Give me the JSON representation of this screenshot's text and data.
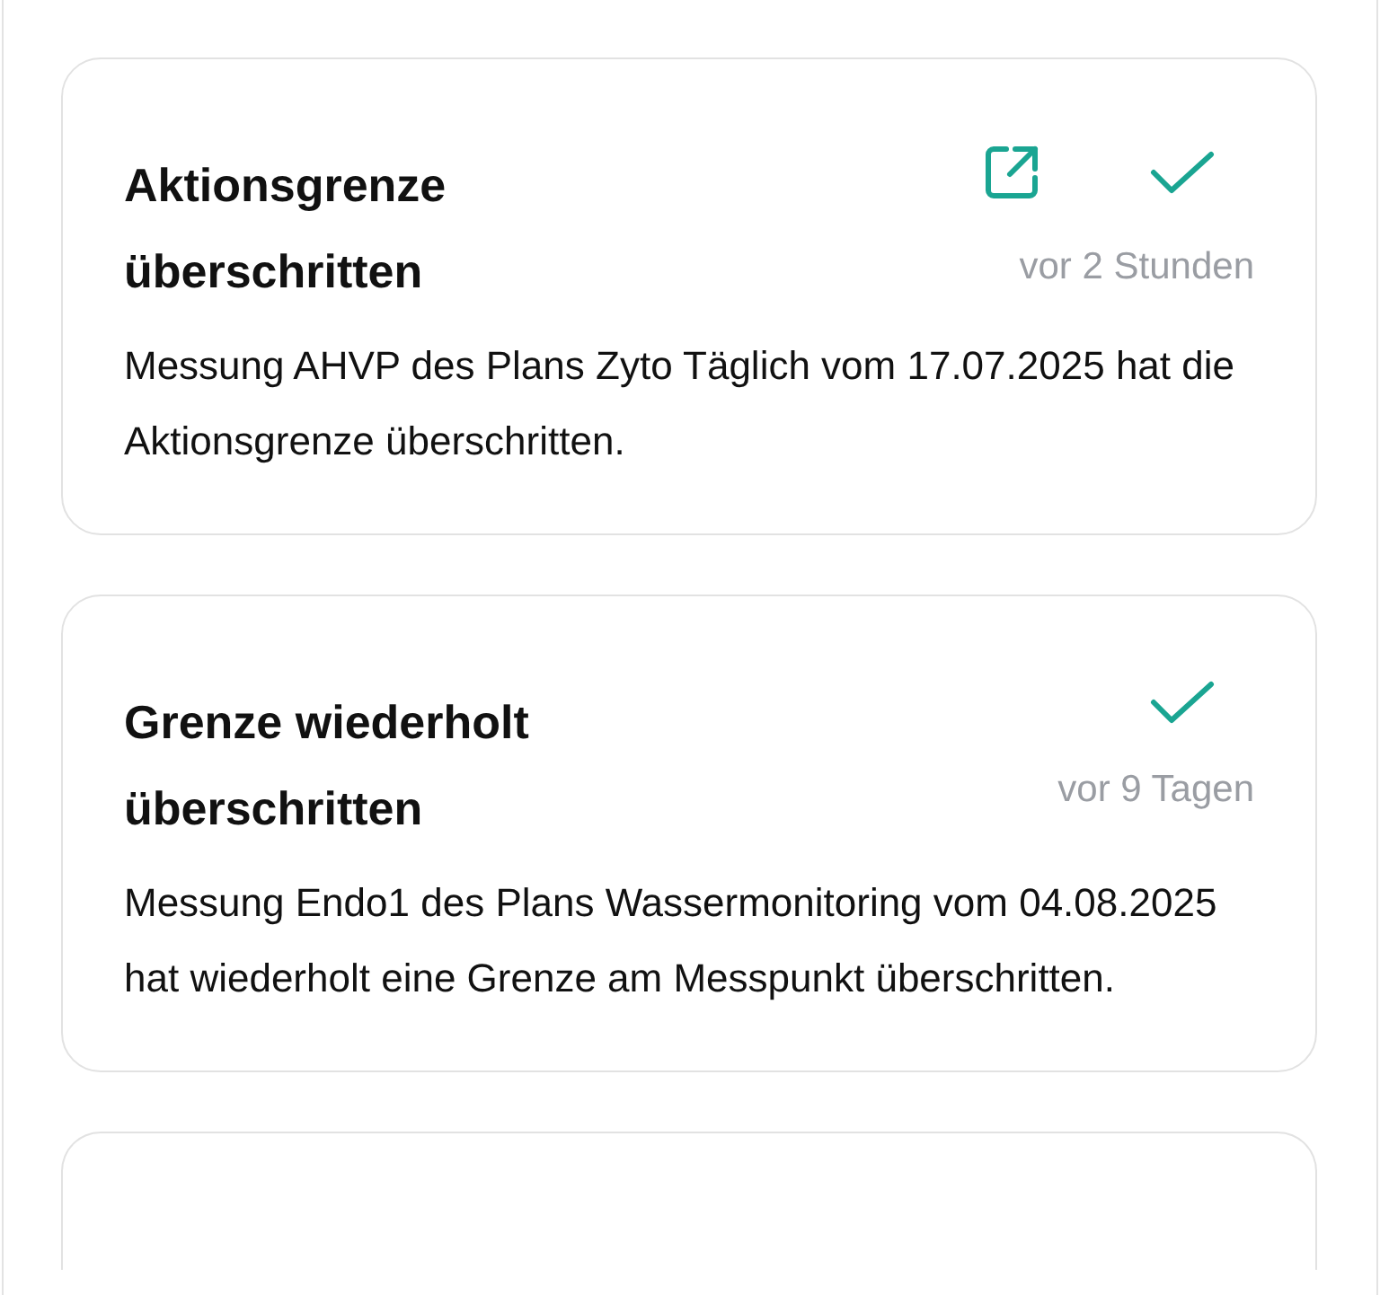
{
  "notifications": [
    {
      "title": "Aktionsgrenze überschritten",
      "has_link": true,
      "time": "vor 2 Stunden",
      "message": "Messung AHVP des Plans Zyto Täglich vom 17.07.2025 hat die Aktionsgrenze überschritten."
    },
    {
      "title": "Grenze wiederholt überschritten",
      "has_link": false,
      "time": "vor 9 Tagen",
      "message": "Messung Endo1 des Plans Wassermonitoring vom 04.08.2025 hat wiederholt eine Grenze am Messpunkt überschritten."
    }
  ]
}
